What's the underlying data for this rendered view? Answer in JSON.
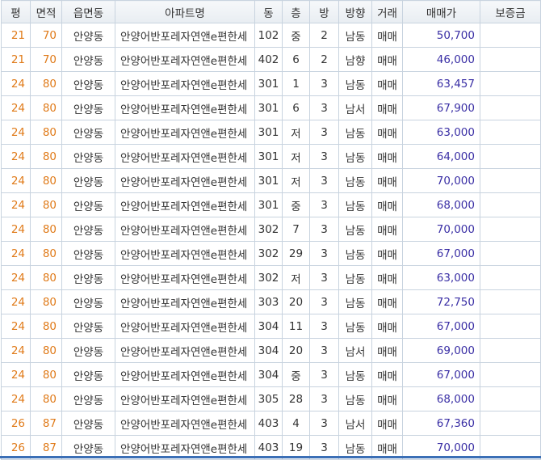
{
  "table": {
    "headers": [
      "평",
      "면적",
      "읍면동",
      "아파트명",
      "동",
      "층",
      "방",
      "방향",
      "거래",
      "매매가",
      "보증금"
    ],
    "rows": [
      {
        "pyeong": "21",
        "area": "70",
        "town": "안양동",
        "apt": "안양어반포레자연앤e편한세",
        "dong": "102",
        "floor": "중",
        "rooms": "2",
        "dir": "남동",
        "deal": "매매",
        "price": "50,700",
        "deposit": ""
      },
      {
        "pyeong": "21",
        "area": "70",
        "town": "안양동",
        "apt": "안양어반포레자연앤e편한세",
        "dong": "402",
        "floor": "6",
        "rooms": "2",
        "dir": "남향",
        "deal": "매매",
        "price": "46,000",
        "deposit": ""
      },
      {
        "pyeong": "24",
        "area": "80",
        "town": "안양동",
        "apt": "안양어반포레자연앤e편한세",
        "dong": "301",
        "floor": "1",
        "rooms": "3",
        "dir": "남동",
        "deal": "매매",
        "price": "63,457",
        "deposit": ""
      },
      {
        "pyeong": "24",
        "area": "80",
        "town": "안양동",
        "apt": "안양어반포레자연앤e편한세",
        "dong": "301",
        "floor": "6",
        "rooms": "3",
        "dir": "남서",
        "deal": "매매",
        "price": "67,900",
        "deposit": ""
      },
      {
        "pyeong": "24",
        "area": "80",
        "town": "안양동",
        "apt": "안양어반포레자연앤e편한세",
        "dong": "301",
        "floor": "저",
        "rooms": "3",
        "dir": "남동",
        "deal": "매매",
        "price": "63,000",
        "deposit": ""
      },
      {
        "pyeong": "24",
        "area": "80",
        "town": "안양동",
        "apt": "안양어반포레자연앤e편한세",
        "dong": "301",
        "floor": "저",
        "rooms": "3",
        "dir": "남동",
        "deal": "매매",
        "price": "64,000",
        "deposit": ""
      },
      {
        "pyeong": "24",
        "area": "80",
        "town": "안양동",
        "apt": "안양어반포레자연앤e편한세",
        "dong": "301",
        "floor": "저",
        "rooms": "3",
        "dir": "남동",
        "deal": "매매",
        "price": "70,000",
        "deposit": ""
      },
      {
        "pyeong": "24",
        "area": "80",
        "town": "안양동",
        "apt": "안양어반포레자연앤e편한세",
        "dong": "301",
        "floor": "중",
        "rooms": "3",
        "dir": "남동",
        "deal": "매매",
        "price": "68,000",
        "deposit": ""
      },
      {
        "pyeong": "24",
        "area": "80",
        "town": "안양동",
        "apt": "안양어반포레자연앤e편한세",
        "dong": "302",
        "floor": "7",
        "rooms": "3",
        "dir": "남동",
        "deal": "매매",
        "price": "70,000",
        "deposit": ""
      },
      {
        "pyeong": "24",
        "area": "80",
        "town": "안양동",
        "apt": "안양어반포레자연앤e편한세",
        "dong": "302",
        "floor": "29",
        "rooms": "3",
        "dir": "남동",
        "deal": "매매",
        "price": "67,000",
        "deposit": ""
      },
      {
        "pyeong": "24",
        "area": "80",
        "town": "안양동",
        "apt": "안양어반포레자연앤e편한세",
        "dong": "302",
        "floor": "저",
        "rooms": "3",
        "dir": "남동",
        "deal": "매매",
        "price": "63,000",
        "deposit": ""
      },
      {
        "pyeong": "24",
        "area": "80",
        "town": "안양동",
        "apt": "안양어반포레자연앤e편한세",
        "dong": "303",
        "floor": "20",
        "rooms": "3",
        "dir": "남동",
        "deal": "매매",
        "price": "72,750",
        "deposit": ""
      },
      {
        "pyeong": "24",
        "area": "80",
        "town": "안양동",
        "apt": "안양어반포레자연앤e편한세",
        "dong": "304",
        "floor": "11",
        "rooms": "3",
        "dir": "남동",
        "deal": "매매",
        "price": "67,000",
        "deposit": ""
      },
      {
        "pyeong": "24",
        "area": "80",
        "town": "안양동",
        "apt": "안양어반포레자연앤e편한세",
        "dong": "304",
        "floor": "20",
        "rooms": "3",
        "dir": "남서",
        "deal": "매매",
        "price": "69,000",
        "deposit": ""
      },
      {
        "pyeong": "24",
        "area": "80",
        "town": "안양동",
        "apt": "안양어반포레자연앤e편한세",
        "dong": "304",
        "floor": "중",
        "rooms": "3",
        "dir": "남동",
        "deal": "매매",
        "price": "67,000",
        "deposit": ""
      },
      {
        "pyeong": "24",
        "area": "80",
        "town": "안양동",
        "apt": "안양어반포레자연앤e편한세",
        "dong": "305",
        "floor": "28",
        "rooms": "3",
        "dir": "남동",
        "deal": "매매",
        "price": "68,000",
        "deposit": ""
      },
      {
        "pyeong": "26",
        "area": "87",
        "town": "안양동",
        "apt": "안양어반포레자연앤e편한세",
        "dong": "403",
        "floor": "4",
        "rooms": "3",
        "dir": "남서",
        "deal": "매매",
        "price": "67,360",
        "deposit": ""
      },
      {
        "pyeong": "26",
        "area": "87",
        "town": "안양동",
        "apt": "안양어반포레자연앤e편한세",
        "dong": "403",
        "floor": "19",
        "rooms": "3",
        "dir": "남동",
        "deal": "매매",
        "price": "70,000",
        "deposit": ""
      }
    ]
  },
  "colors": {
    "accent_orange": "#e07b1a",
    "price_blue": "#3a2fa5",
    "border": "#c8d3df",
    "bottom_bar": "#3b6fb6"
  }
}
